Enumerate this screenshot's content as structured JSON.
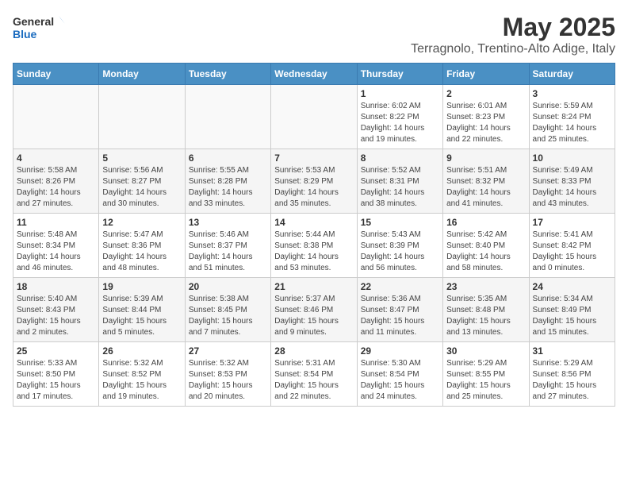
{
  "logo": {
    "line1": "General",
    "line2": "Blue"
  },
  "title": "May 2025",
  "subtitle": "Terragnolo, Trentino-Alto Adige, Italy",
  "days_of_week": [
    "Sunday",
    "Monday",
    "Tuesday",
    "Wednesday",
    "Thursday",
    "Friday",
    "Saturday"
  ],
  "weeks": [
    [
      {
        "day": "",
        "info": ""
      },
      {
        "day": "",
        "info": ""
      },
      {
        "day": "",
        "info": ""
      },
      {
        "day": "",
        "info": ""
      },
      {
        "day": "1",
        "info": "Sunrise: 6:02 AM\nSunset: 8:22 PM\nDaylight: 14 hours\nand 19 minutes."
      },
      {
        "day": "2",
        "info": "Sunrise: 6:01 AM\nSunset: 8:23 PM\nDaylight: 14 hours\nand 22 minutes."
      },
      {
        "day": "3",
        "info": "Sunrise: 5:59 AM\nSunset: 8:24 PM\nDaylight: 14 hours\nand 25 minutes."
      }
    ],
    [
      {
        "day": "4",
        "info": "Sunrise: 5:58 AM\nSunset: 8:26 PM\nDaylight: 14 hours\nand 27 minutes."
      },
      {
        "day": "5",
        "info": "Sunrise: 5:56 AM\nSunset: 8:27 PM\nDaylight: 14 hours\nand 30 minutes."
      },
      {
        "day": "6",
        "info": "Sunrise: 5:55 AM\nSunset: 8:28 PM\nDaylight: 14 hours\nand 33 minutes."
      },
      {
        "day": "7",
        "info": "Sunrise: 5:53 AM\nSunset: 8:29 PM\nDaylight: 14 hours\nand 35 minutes."
      },
      {
        "day": "8",
        "info": "Sunrise: 5:52 AM\nSunset: 8:31 PM\nDaylight: 14 hours\nand 38 minutes."
      },
      {
        "day": "9",
        "info": "Sunrise: 5:51 AM\nSunset: 8:32 PM\nDaylight: 14 hours\nand 41 minutes."
      },
      {
        "day": "10",
        "info": "Sunrise: 5:49 AM\nSunset: 8:33 PM\nDaylight: 14 hours\nand 43 minutes."
      }
    ],
    [
      {
        "day": "11",
        "info": "Sunrise: 5:48 AM\nSunset: 8:34 PM\nDaylight: 14 hours\nand 46 minutes."
      },
      {
        "day": "12",
        "info": "Sunrise: 5:47 AM\nSunset: 8:36 PM\nDaylight: 14 hours\nand 48 minutes."
      },
      {
        "day": "13",
        "info": "Sunrise: 5:46 AM\nSunset: 8:37 PM\nDaylight: 14 hours\nand 51 minutes."
      },
      {
        "day": "14",
        "info": "Sunrise: 5:44 AM\nSunset: 8:38 PM\nDaylight: 14 hours\nand 53 minutes."
      },
      {
        "day": "15",
        "info": "Sunrise: 5:43 AM\nSunset: 8:39 PM\nDaylight: 14 hours\nand 56 minutes."
      },
      {
        "day": "16",
        "info": "Sunrise: 5:42 AM\nSunset: 8:40 PM\nDaylight: 14 hours\nand 58 minutes."
      },
      {
        "day": "17",
        "info": "Sunrise: 5:41 AM\nSunset: 8:42 PM\nDaylight: 15 hours\nand 0 minutes."
      }
    ],
    [
      {
        "day": "18",
        "info": "Sunrise: 5:40 AM\nSunset: 8:43 PM\nDaylight: 15 hours\nand 2 minutes."
      },
      {
        "day": "19",
        "info": "Sunrise: 5:39 AM\nSunset: 8:44 PM\nDaylight: 15 hours\nand 5 minutes."
      },
      {
        "day": "20",
        "info": "Sunrise: 5:38 AM\nSunset: 8:45 PM\nDaylight: 15 hours\nand 7 minutes."
      },
      {
        "day": "21",
        "info": "Sunrise: 5:37 AM\nSunset: 8:46 PM\nDaylight: 15 hours\nand 9 minutes."
      },
      {
        "day": "22",
        "info": "Sunrise: 5:36 AM\nSunset: 8:47 PM\nDaylight: 15 hours\nand 11 minutes."
      },
      {
        "day": "23",
        "info": "Sunrise: 5:35 AM\nSunset: 8:48 PM\nDaylight: 15 hours\nand 13 minutes."
      },
      {
        "day": "24",
        "info": "Sunrise: 5:34 AM\nSunset: 8:49 PM\nDaylight: 15 hours\nand 15 minutes."
      }
    ],
    [
      {
        "day": "25",
        "info": "Sunrise: 5:33 AM\nSunset: 8:50 PM\nDaylight: 15 hours\nand 17 minutes."
      },
      {
        "day": "26",
        "info": "Sunrise: 5:32 AM\nSunset: 8:52 PM\nDaylight: 15 hours\nand 19 minutes."
      },
      {
        "day": "27",
        "info": "Sunrise: 5:32 AM\nSunset: 8:53 PM\nDaylight: 15 hours\nand 20 minutes."
      },
      {
        "day": "28",
        "info": "Sunrise: 5:31 AM\nSunset: 8:54 PM\nDaylight: 15 hours\nand 22 minutes."
      },
      {
        "day": "29",
        "info": "Sunrise: 5:30 AM\nSunset: 8:54 PM\nDaylight: 15 hours\nand 24 minutes."
      },
      {
        "day": "30",
        "info": "Sunrise: 5:29 AM\nSunset: 8:55 PM\nDaylight: 15 hours\nand 25 minutes."
      },
      {
        "day": "31",
        "info": "Sunrise: 5:29 AM\nSunset: 8:56 PM\nDaylight: 15 hours\nand 27 minutes."
      }
    ]
  ]
}
